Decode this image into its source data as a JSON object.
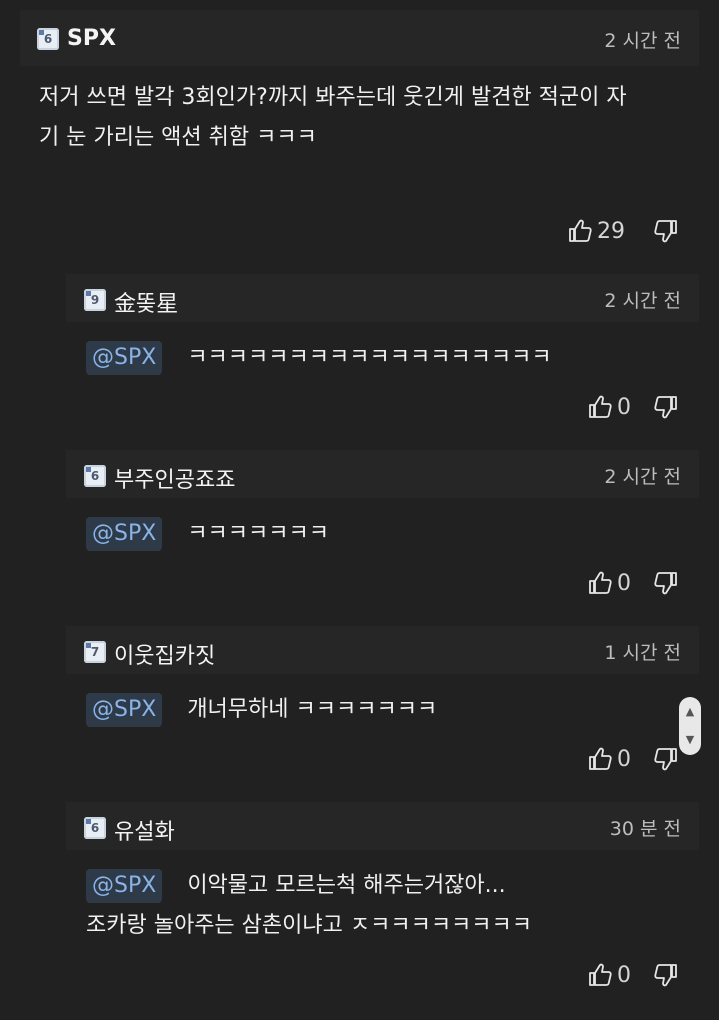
{
  "comments": [
    {
      "author": "SPX",
      "level": "6",
      "time": "2 시간 전",
      "text_line1": "저거 쓰면 발각 3회인가?까지 봐주는데 웃긴게 발견한 적군이 자",
      "text_line2": "기 눈 가리는 액션 취함 ㅋㅋㅋ",
      "likes": "29"
    }
  ],
  "replies": [
    {
      "author": "金똦星",
      "level": "9",
      "time": "2 시간 전",
      "mention": "@SPX",
      "text": "ㅋㅋㅋㅋㅋㅋㅋㅋㅋㅋㅋㅋㅋㅋㅋㅋㅋㅋ",
      "likes": "0"
    },
    {
      "author": "부주인공죠죠",
      "level": "6",
      "time": "2 시간 전",
      "mention": "@SPX",
      "text": "ㅋㅋㅋㅋㅋㅋㅋ",
      "likes": "0"
    },
    {
      "author": "이웃집카짓",
      "level": "7",
      "time": "1 시간 전",
      "mention": "@SPX",
      "text": "개너무하네 ㅋㅋㅋㅋㅋㅋㅋ",
      "likes": "0"
    },
    {
      "author": "유설화",
      "level": "6",
      "time": "30 분 전",
      "mention": "@SPX",
      "text": "이악물고 모르는척 해주는거잖아...",
      "text_line2": "조카랑 놀아주는 삼촌이냐고 ㅈㅋㅋㅋㅋㅋㅋㅋㅋ",
      "likes": "0"
    }
  ],
  "icons": {
    "like": "thumbs-up-icon",
    "dislike": "thumbs-down-icon"
  },
  "colors": {
    "background": "#212121",
    "header": "#262626",
    "mention_bg": "#2e3a48",
    "mention_text": "#8ab4e8"
  }
}
